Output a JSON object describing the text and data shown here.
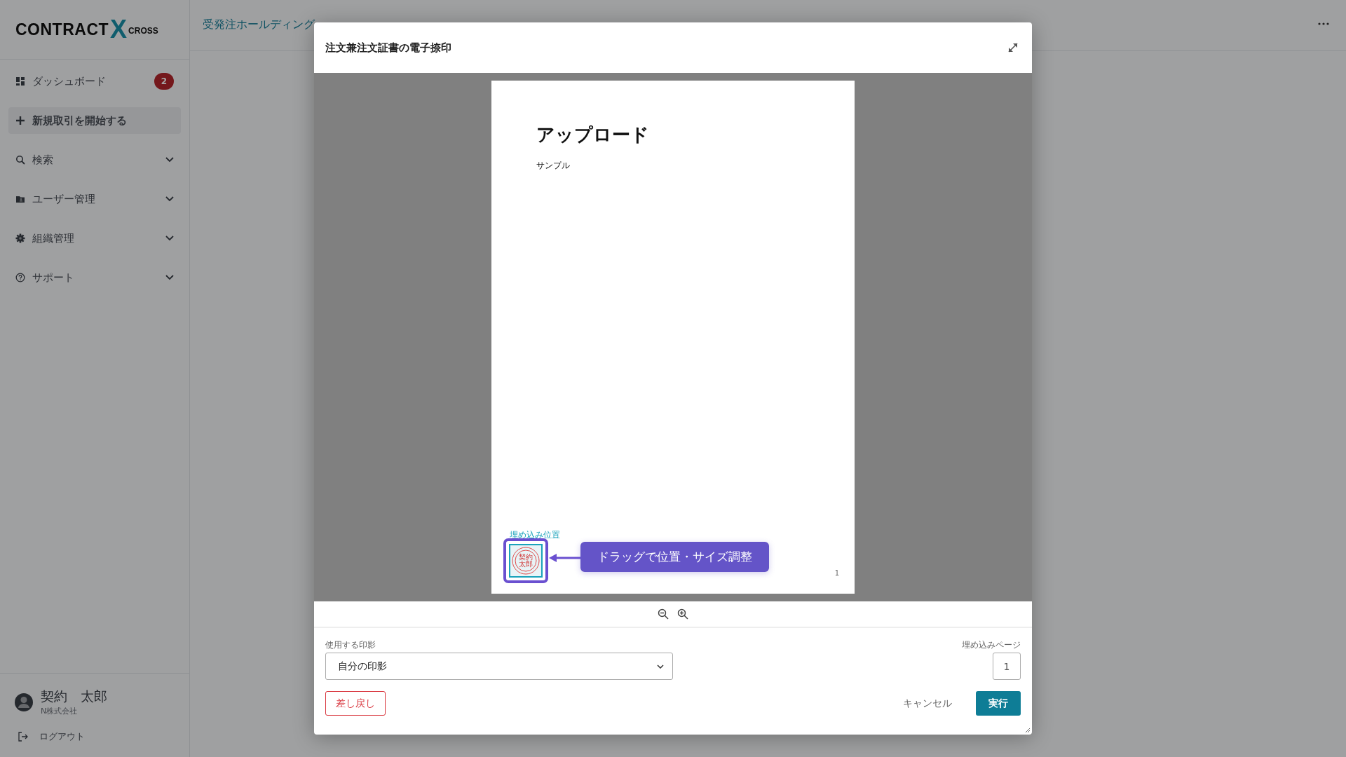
{
  "logo": {
    "word": "CONTRACT",
    "mark": "X",
    "suffix": "CROSS"
  },
  "sidebar": {
    "items": [
      {
        "kind": "link",
        "label": "ダッシュボード",
        "badge": "2"
      },
      {
        "kind": "action",
        "label": "新規取引を開始する"
      },
      {
        "kind": "menu",
        "label": "検索"
      },
      {
        "kind": "menu",
        "label": "ユーザー管理"
      },
      {
        "kind": "menu",
        "label": "組織管理"
      },
      {
        "kind": "menu",
        "label": "サポート"
      }
    ],
    "user": {
      "name": "契約　太郎",
      "company": "N株式会社"
    },
    "logout": "ログアウト"
  },
  "header": {
    "breadcrumb": "受発注ホールディング"
  },
  "modal": {
    "title": "注文兼注文証書の電子捺印",
    "document": {
      "heading": "アップロード",
      "body": "サンプル",
      "page_number": "1",
      "stamp": {
        "label": "埋め込み位置",
        "seal_lines": [
          "契約",
          "太郎"
        ]
      },
      "callout": "ドラッグで位置・サイズ調整"
    },
    "seal_field": {
      "label": "使用する印影",
      "value": "自分の印影"
    },
    "page_field": {
      "label": "埋め込みページ",
      "value": "1"
    },
    "buttons": [
      {
        "kind": "danger",
        "label": "差し戻し"
      },
      {
        "kind": "text",
        "label": "キャンセル"
      },
      {
        "kind": "primary",
        "label": "実行"
      }
    ]
  }
}
